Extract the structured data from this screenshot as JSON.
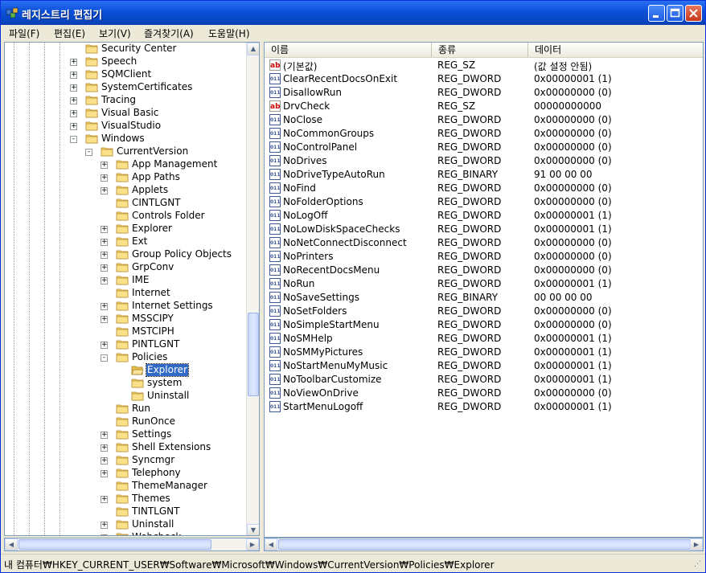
{
  "window": {
    "title": "레지스트리 편집기"
  },
  "menu": [
    "파일(F)",
    "편집(E)",
    "보기(V)",
    "즐겨찾기(A)",
    "도움말(H)"
  ],
  "tree": [
    {
      "label": "Security Center",
      "level": 1,
      "expander": "none"
    },
    {
      "label": "Speech",
      "level": 1,
      "expander": "+"
    },
    {
      "label": "SQMClient",
      "level": 1,
      "expander": "+"
    },
    {
      "label": "SystemCertificates",
      "level": 1,
      "expander": "+"
    },
    {
      "label": "Tracing",
      "level": 1,
      "expander": "+"
    },
    {
      "label": "Visual Basic",
      "level": 1,
      "expander": "+"
    },
    {
      "label": "VisualStudio",
      "level": 1,
      "expander": "+"
    },
    {
      "label": "Windows",
      "level": 1,
      "expander": "-"
    },
    {
      "label": "CurrentVersion",
      "level": 2,
      "expander": "-"
    },
    {
      "label": "App Management",
      "level": 3,
      "expander": "+"
    },
    {
      "label": "App Paths",
      "level": 3,
      "expander": "+"
    },
    {
      "label": "Applets",
      "level": 3,
      "expander": "+"
    },
    {
      "label": "CINTLGNT",
      "level": 3,
      "expander": "none"
    },
    {
      "label": "Controls Folder",
      "level": 3,
      "expander": "none"
    },
    {
      "label": "Explorer",
      "level": 3,
      "expander": "+"
    },
    {
      "label": "Ext",
      "level": 3,
      "expander": "+"
    },
    {
      "label": "Group Policy Objects",
      "level": 3,
      "expander": "+"
    },
    {
      "label": "GrpConv",
      "level": 3,
      "expander": "+"
    },
    {
      "label": "IME",
      "level": 3,
      "expander": "+"
    },
    {
      "label": "Internet",
      "level": 3,
      "expander": "none"
    },
    {
      "label": "Internet Settings",
      "level": 3,
      "expander": "+"
    },
    {
      "label": "MSSCIPY",
      "level": 3,
      "expander": "+"
    },
    {
      "label": "MSTCIPH",
      "level": 3,
      "expander": "none"
    },
    {
      "label": "PINTLGNT",
      "level": 3,
      "expander": "+"
    },
    {
      "label": "Policies",
      "level": 3,
      "expander": "-"
    },
    {
      "label": "Explorer",
      "level": 4,
      "expander": "none",
      "selected": true
    },
    {
      "label": "system",
      "level": 4,
      "expander": "none"
    },
    {
      "label": "Uninstall",
      "level": 4,
      "expander": "none"
    },
    {
      "label": "Run",
      "level": 3,
      "expander": "none"
    },
    {
      "label": "RunOnce",
      "level": 3,
      "expander": "none"
    },
    {
      "label": "Settings",
      "level": 3,
      "expander": "+"
    },
    {
      "label": "Shell Extensions",
      "level": 3,
      "expander": "+"
    },
    {
      "label": "Syncmgr",
      "level": 3,
      "expander": "+"
    },
    {
      "label": "Telephony",
      "level": 3,
      "expander": "+"
    },
    {
      "label": "ThemeManager",
      "level": 3,
      "expander": "none"
    },
    {
      "label": "Themes",
      "level": 3,
      "expander": "+"
    },
    {
      "label": "TINTLGNT",
      "level": 3,
      "expander": "none"
    },
    {
      "label": "Uninstall",
      "level": 3,
      "expander": "+"
    },
    {
      "label": "Webcheck",
      "level": 3,
      "expander": "+"
    }
  ],
  "list": {
    "columns": [
      "이름",
      "종류",
      "데이터"
    ],
    "rows": [
      {
        "name": "(기본값)",
        "type": "REG_SZ",
        "data": "(값 설정 안됨)",
        "icon": "ab"
      },
      {
        "name": "ClearRecentDocsOnExit",
        "type": "REG_DWORD",
        "data": "0x00000001 (1)",
        "icon": "bin"
      },
      {
        "name": "DisallowRun",
        "type": "REG_DWORD",
        "data": "0x00000000 (0)",
        "icon": "bin"
      },
      {
        "name": "DrvCheck",
        "type": "REG_SZ",
        "data": "00000000000",
        "icon": "ab"
      },
      {
        "name": "NoClose",
        "type": "REG_DWORD",
        "data": "0x00000000 (0)",
        "icon": "bin"
      },
      {
        "name": "NoCommonGroups",
        "type": "REG_DWORD",
        "data": "0x00000000 (0)",
        "icon": "bin"
      },
      {
        "name": "NoControlPanel",
        "type": "REG_DWORD",
        "data": "0x00000000 (0)",
        "icon": "bin"
      },
      {
        "name": "NoDrives",
        "type": "REG_DWORD",
        "data": "0x00000000 (0)",
        "icon": "bin"
      },
      {
        "name": "NoDriveTypeAutoRun",
        "type": "REG_BINARY",
        "data": "91 00 00 00",
        "icon": "bin"
      },
      {
        "name": "NoFind",
        "type": "REG_DWORD",
        "data": "0x00000000 (0)",
        "icon": "bin"
      },
      {
        "name": "NoFolderOptions",
        "type": "REG_DWORD",
        "data": "0x00000000 (0)",
        "icon": "bin"
      },
      {
        "name": "NoLogOff",
        "type": "REG_DWORD",
        "data": "0x00000001 (1)",
        "icon": "bin"
      },
      {
        "name": "NoLowDiskSpaceChecks",
        "type": "REG_DWORD",
        "data": "0x00000001 (1)",
        "icon": "bin"
      },
      {
        "name": "NoNetConnectDisconnect",
        "type": "REG_DWORD",
        "data": "0x00000000 (0)",
        "icon": "bin"
      },
      {
        "name": "NoPrinters",
        "type": "REG_DWORD",
        "data": "0x00000000 (0)",
        "icon": "bin"
      },
      {
        "name": "NoRecentDocsMenu",
        "type": "REG_DWORD",
        "data": "0x00000000 (0)",
        "icon": "bin"
      },
      {
        "name": "NoRun",
        "type": "REG_DWORD",
        "data": "0x00000001 (1)",
        "icon": "bin"
      },
      {
        "name": "NoSaveSettings",
        "type": "REG_BINARY",
        "data": "00 00 00 00",
        "icon": "bin"
      },
      {
        "name": "NoSetFolders",
        "type": "REG_DWORD",
        "data": "0x00000000 (0)",
        "icon": "bin"
      },
      {
        "name": "NoSimpleStartMenu",
        "type": "REG_DWORD",
        "data": "0x00000000 (0)",
        "icon": "bin"
      },
      {
        "name": "NoSMHelp",
        "type": "REG_DWORD",
        "data": "0x00000001 (1)",
        "icon": "bin"
      },
      {
        "name": "NoSMMyPictures",
        "type": "REG_DWORD",
        "data": "0x00000001 (1)",
        "icon": "bin"
      },
      {
        "name": "NoStartMenuMyMusic",
        "type": "REG_DWORD",
        "data": "0x00000001 (1)",
        "icon": "bin"
      },
      {
        "name": "NoToolbarCustomize",
        "type": "REG_DWORD",
        "data": "0x00000001 (1)",
        "icon": "bin"
      },
      {
        "name": "NoViewOnDrive",
        "type": "REG_DWORD",
        "data": "0x00000000 (0)",
        "icon": "bin"
      },
      {
        "name": "StartMenuLogoff",
        "type": "REG_DWORD",
        "data": "0x00000001 (1)",
        "icon": "bin"
      }
    ]
  },
  "status": {
    "path": "내 컴퓨터₩HKEY_CURRENT_USER₩Software₩Microsoft₩Windows₩CurrentVersion₩Policies₩Explorer"
  },
  "icons": {
    "folder": "folder-icon",
    "string_value": "string-value-icon",
    "binary_value": "binary-value-icon"
  },
  "colors": {
    "titlebar": "#0a50d8",
    "selection": "#316ac5",
    "folder": "#f7d26b"
  }
}
